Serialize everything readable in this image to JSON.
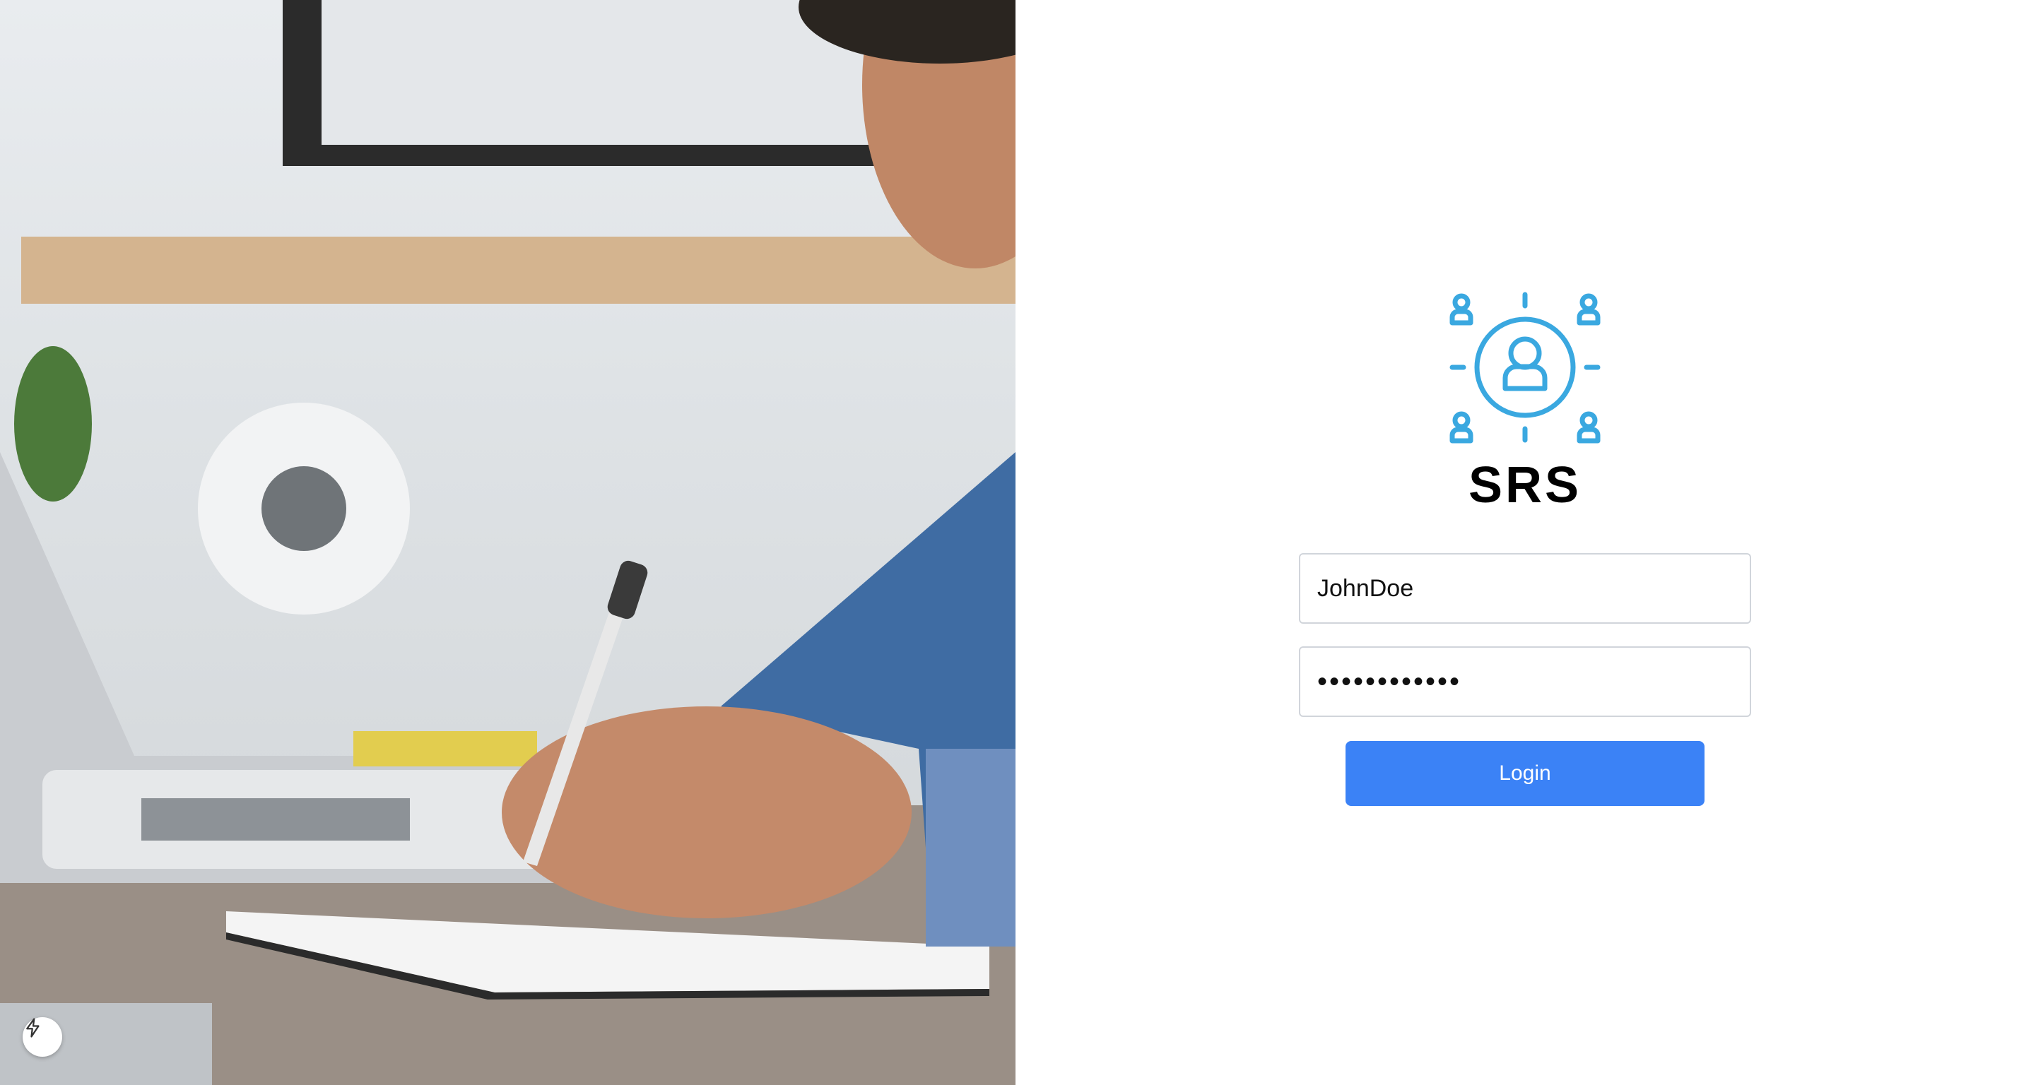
{
  "login": {
    "brand": "SRS",
    "username_value": "JohnDoe",
    "password_value": "••••••••••••",
    "login_label": "Login"
  },
  "colors": {
    "accent": "#3b82f6",
    "logo": "#3aa8e0"
  },
  "icons": {
    "logo": "user-network-icon",
    "dev_badge": "lightning-bolt-icon"
  }
}
